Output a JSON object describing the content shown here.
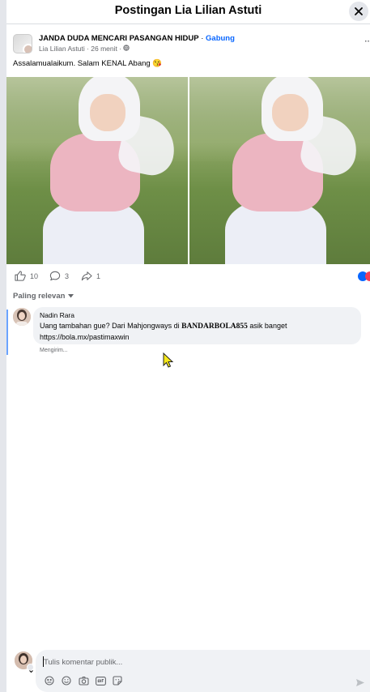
{
  "header": {
    "title": "Postingan Lia Lilian Astuti"
  },
  "post": {
    "group_name": "JANDA DUDA MENCARI PASANGAN HIDUP",
    "join_label": "Gabung",
    "author": "Lia Lilian Astuti",
    "time": "26 menit",
    "text": "Assalamualaikum. Salam KENAL Abang 😘",
    "photo_count": 2
  },
  "stats": {
    "likes": "10",
    "comments": "3",
    "shares": "1"
  },
  "sort_label": "Paling relevan",
  "comment": {
    "author": "Nadin Rara",
    "text_before": "Uang tambahan gue? Dari Mahjongways di ",
    "text_bold": "BANDARBOLA855",
    "text_after": " asik banget",
    "link_line": "https://bola.mx/pastimaxwin",
    "status": "Mengirim..."
  },
  "composer": {
    "placeholder": "Tulis komentar publik..."
  },
  "colors": {
    "accent": "#0866ff",
    "bubble": "#f0f2f5",
    "muted": "#65676b"
  }
}
